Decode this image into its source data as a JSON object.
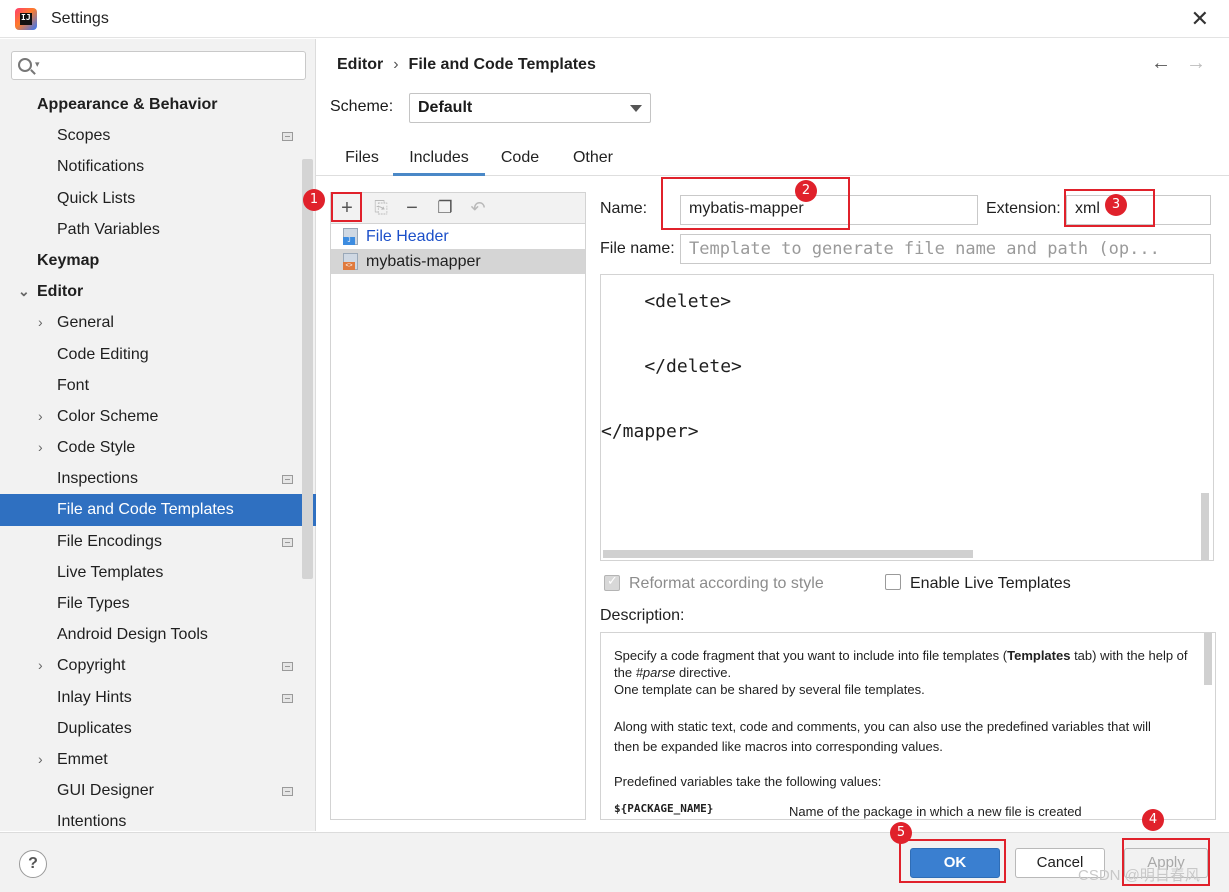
{
  "window": {
    "title": "Settings",
    "close_icon": "close-icon"
  },
  "sidebar": {
    "search_placeholder": "",
    "items": [
      {
        "label": "Appearance & Behavior",
        "level": 0,
        "chevron": "",
        "proj": false
      },
      {
        "label": "Scopes",
        "level": 1,
        "chevron": "",
        "proj": true
      },
      {
        "label": "Notifications",
        "level": 1,
        "chevron": "",
        "proj": false
      },
      {
        "label": "Quick Lists",
        "level": 1,
        "chevron": "",
        "proj": false
      },
      {
        "label": "Path Variables",
        "level": 1,
        "chevron": "",
        "proj": false
      },
      {
        "label": "Keymap",
        "level": 0,
        "chevron": "",
        "proj": false
      },
      {
        "label": "Editor",
        "level": 0,
        "chevron": "down",
        "proj": false
      },
      {
        "label": "General",
        "level": 1,
        "chevron": "right",
        "proj": false
      },
      {
        "label": "Code Editing",
        "level": 1,
        "chevron": "",
        "proj": false
      },
      {
        "label": "Font",
        "level": 1,
        "chevron": "",
        "proj": false
      },
      {
        "label": "Color Scheme",
        "level": 1,
        "chevron": "right",
        "proj": false
      },
      {
        "label": "Code Style",
        "level": 1,
        "chevron": "right",
        "proj": false
      },
      {
        "label": "Inspections",
        "level": 1,
        "chevron": "",
        "proj": true
      },
      {
        "label": "File and Code Templates",
        "level": 1,
        "chevron": "",
        "proj": false,
        "selected": true
      },
      {
        "label": "File Encodings",
        "level": 1,
        "chevron": "",
        "proj": true
      },
      {
        "label": "Live Templates",
        "level": 1,
        "chevron": "",
        "proj": false
      },
      {
        "label": "File Types",
        "level": 1,
        "chevron": "",
        "proj": false
      },
      {
        "label": "Android Design Tools",
        "level": 1,
        "chevron": "",
        "proj": false
      },
      {
        "label": "Copyright",
        "level": 1,
        "chevron": "right",
        "proj": true
      },
      {
        "label": "Inlay Hints",
        "level": 1,
        "chevron": "",
        "proj": true
      },
      {
        "label": "Duplicates",
        "level": 1,
        "chevron": "",
        "proj": false
      },
      {
        "label": "Emmet",
        "level": 1,
        "chevron": "right",
        "proj": false
      },
      {
        "label": "GUI Designer",
        "level": 1,
        "chevron": "",
        "proj": true
      },
      {
        "label": "Intentions",
        "level": 1,
        "chevron": "",
        "proj": false
      }
    ]
  },
  "header": {
    "breadcrumb_root": "Editor",
    "breadcrumb_sep": "›",
    "breadcrumb_page": "File and Code Templates",
    "scheme_label": "Scheme:",
    "scheme_value": "Default"
  },
  "tabs": [
    {
      "label": "Files",
      "active": false
    },
    {
      "label": "Includes",
      "active": true
    },
    {
      "label": "Code",
      "active": false
    },
    {
      "label": "Other",
      "active": false
    }
  ],
  "template_list": {
    "items": [
      {
        "label": "File Header",
        "type": "java",
        "selected": false
      },
      {
        "label": "mybatis-mapper",
        "type": "xml",
        "selected": true
      }
    ]
  },
  "form": {
    "name_label": "Name:",
    "name_value": "mybatis-mapper",
    "extension_label": "Extension:",
    "extension_value": "xml",
    "filename_label": "File name:",
    "filename_placeholder": "Template to generate file name and path (op..."
  },
  "editor": {
    "lines": [
      {
        "text": "    <delete>"
      },
      {
        "text": "    </delete>"
      },
      {
        "text": "</mapper>"
      }
    ]
  },
  "options": {
    "reformat_label": "Reformat according to style",
    "reformat_checked": true,
    "live_templates_label": "Enable Live Templates",
    "live_templates_checked": false
  },
  "description": {
    "label": "Description:",
    "p1_a": "Specify a code fragment that you want to include into file templates (",
    "p1_bold": "Templates",
    "p1_b": " tab) with the help of the ",
    "p1_italic": "#parse",
    "p1_c": " directive.",
    "p1_line2": "One template can be shared by several file templates.",
    "p2": "Along with static text, code and comments, you can also use the predefined variables that will then be expanded like macros into corresponding values.",
    "p3": "Predefined variables take the following values:",
    "var_name": "${PACKAGE_NAME}",
    "var_desc": "Name of the package in which a new file is created"
  },
  "buttons": {
    "ok": "OK",
    "cancel": "Cancel",
    "apply": "Apply",
    "help": "?"
  },
  "annotations": [
    "1",
    "2",
    "3",
    "4",
    "5"
  ],
  "watermark": "CSDN @明日春风",
  "colors": {
    "selection": "#2f70c1",
    "annotation_red": "#e0212b",
    "link_blue": "#1b4fc9",
    "primary_button": "#3a7fd0"
  }
}
